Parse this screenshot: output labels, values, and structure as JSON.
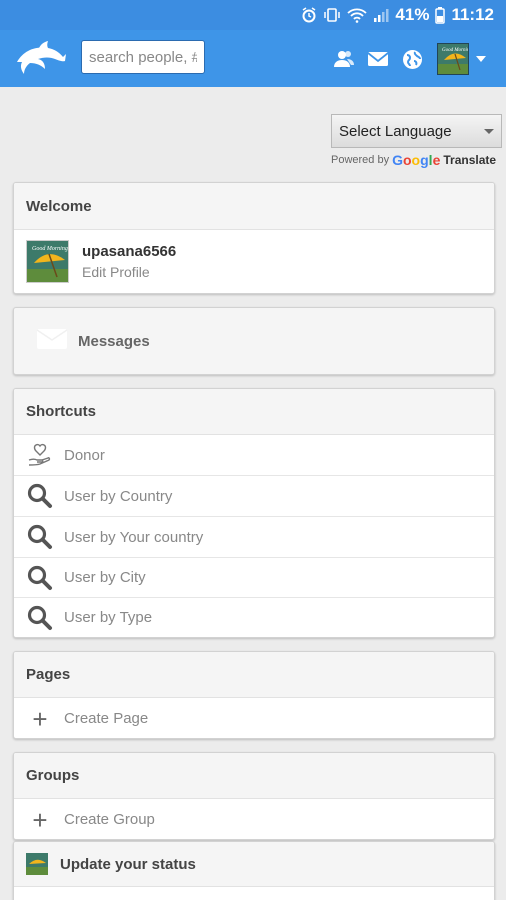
{
  "status_bar": {
    "battery": "41%",
    "time": "11:12"
  },
  "header": {
    "search_placeholder": "search people, #"
  },
  "translate": {
    "select_label": "Select Language",
    "powered_by": "Powered by",
    "google": [
      "G",
      "o",
      "o",
      "g",
      "l",
      "e"
    ],
    "translate": "Translate"
  },
  "welcome": {
    "title": "Welcome",
    "username": "upasana6566",
    "edit_profile": "Edit Profile"
  },
  "messages": {
    "label": "Messages"
  },
  "shortcuts": {
    "title": "Shortcuts",
    "items": [
      {
        "label": "Donor",
        "icon": "donor-hand-icon"
      },
      {
        "label": "User by Country",
        "icon": "search-icon"
      },
      {
        "label": "User by Your country",
        "icon": "search-icon"
      },
      {
        "label": "User by City",
        "icon": "search-icon"
      },
      {
        "label": "User by Type",
        "icon": "search-icon"
      }
    ]
  },
  "pages": {
    "title": "Pages",
    "create": "Create Page"
  },
  "groups": {
    "title": "Groups",
    "create": "Create Group"
  },
  "status_update": {
    "title": "Update your status"
  },
  "colors": {
    "brand_blue": "#3e95e8",
    "status_blue": "#3c8de1",
    "google_blue": "#4285f4",
    "google_red": "#ea4335",
    "google_yellow": "#fbbc05",
    "google_green": "#34a853"
  }
}
